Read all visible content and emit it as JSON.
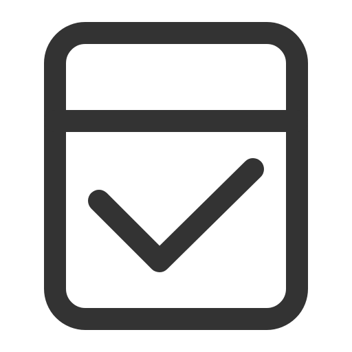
{
  "icon": {
    "name": "document-check-icon",
    "stroke_color": "#333333",
    "background": "#ffffff"
  }
}
